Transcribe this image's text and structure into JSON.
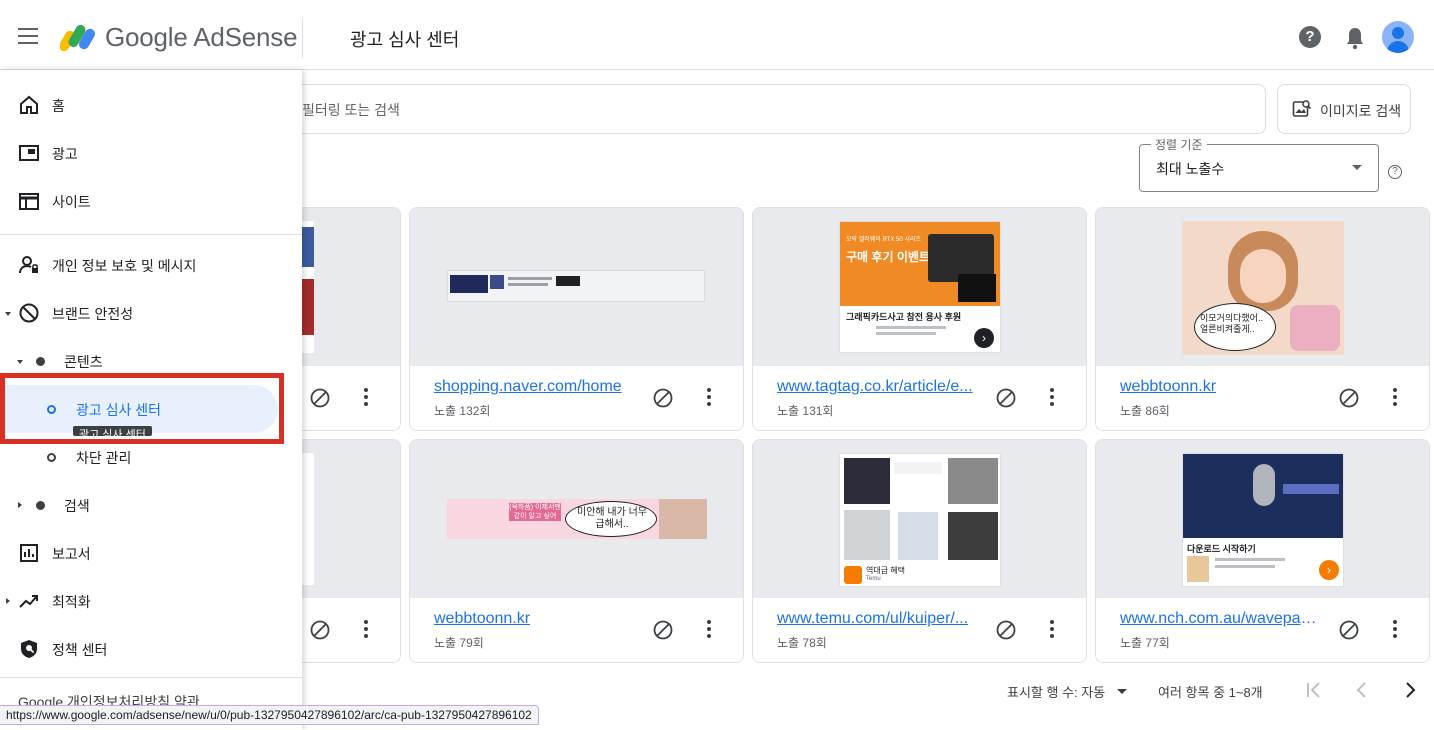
{
  "app": {
    "brand": "Google AdSense",
    "page_title": "광고 심사 센터",
    "colors": {
      "accent": "#1a73e8",
      "highlight": "#d93025",
      "active_bg": "#e8f0fe"
    }
  },
  "toolbar": {
    "search_placeholder": "필터링 또는 검색",
    "image_search_label": "이미지로 검색",
    "sort_label": "정렬 기준",
    "sort_value": "최대 노출수"
  },
  "sidebar": {
    "items": [
      {
        "label": "홈",
        "icon": "home-icon"
      },
      {
        "label": "광고",
        "icon": "ads-icon"
      },
      {
        "label": "사이트",
        "icon": "sites-icon"
      },
      {
        "label": "개인 정보 보호 및 메시지",
        "icon": "privacy-icon"
      },
      {
        "label": "브랜드 안전성",
        "icon": "block-icon"
      },
      {
        "label": "콘텐츠",
        "icon": "dot-icon"
      },
      {
        "label": "광고 심사 센터",
        "icon": "ring-icon"
      },
      {
        "label": "차단 관리",
        "icon": "ring-icon"
      },
      {
        "label": "검색",
        "icon": "dot-icon"
      },
      {
        "label": "보고서",
        "icon": "reports-icon"
      },
      {
        "label": "최적화",
        "icon": "trending-icon"
      },
      {
        "label": "정책 센터",
        "icon": "policy-icon"
      }
    ],
    "tooltip": "광고 심사 센터",
    "footer": "Google  개인정보처리방침  약관"
  },
  "cards": [
    {
      "url": "",
      "count": ""
    },
    {
      "url": "shopping.naver.com/home",
      "count": "노출 132회"
    },
    {
      "url": "www.tagtag.co.kr/article/e...",
      "count": "노출 131회"
    },
    {
      "url": "webbtoonn.kr",
      "count": "노출 86회"
    },
    {
      "url": "",
      "count": ""
    },
    {
      "url": "webbtoonn.kr",
      "count": "노출 79회"
    },
    {
      "url": "www.temu.com/ul/kuiper/...",
      "count": "노출 78회"
    },
    {
      "url": "www.nch.com.au/wavepad...",
      "count": "노출 77회"
    }
  ],
  "ads": {
    "tagtag_header": "구매 후기 이벤트",
    "tagtag_sub": "모락 갤러웨이 RTX 50 시리즈",
    "tagtag_caption": "그래픽카드사고 참전 용사 후원",
    "webtoon_bubble": "이모거의다했어.. 얼른비켜줄게..",
    "banner_bubble": "미안해 내가 너무 급해서..",
    "banner_left": "(욕하품) 이제서맨 같이 알고 싶어",
    "temu_caption": "역대급 혜택",
    "temu_brand": "Temu",
    "nch_caption": "다운로드 시작하기"
  },
  "pagination": {
    "rows_label": "표시할 행 수:  자동",
    "range": "여러 항목 중 1~8개"
  },
  "status_bar": {
    "url": "https://www.google.com/adsense/new/u/0/pub-1327950427896102/arc/ca-pub-1327950427896102"
  }
}
